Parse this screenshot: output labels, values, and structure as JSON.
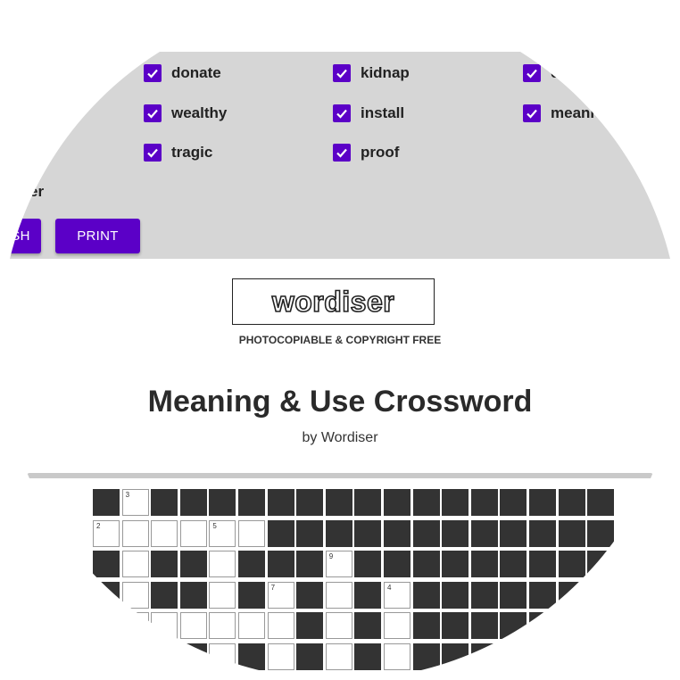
{
  "words": [
    [
      "donate",
      "kidnap",
      "c"
    ],
    [
      "wealthy",
      "install",
      "meani"
    ],
    [
      "tragic",
      "proof",
      ""
    ]
  ],
  "show_answer_label": "nswer",
  "buttons": {
    "left_label": "SH",
    "print_label": "PRINT"
  },
  "logo": {
    "text": "wordiser"
  },
  "photocopy_text": "PHOTOCOPIABLE & COPYRIGHT FREE",
  "title": "Meaning & Use Crossword",
  "byline": "by Wordiser",
  "colors": {
    "accent": "#5b00c7",
    "settings_bg": "#d6d6d6",
    "grid_black": "#333333"
  },
  "grid": {
    "rows": [
      "BWBBBBBBBBBBBBBBBB",
      "WWWWWWBBBBBBBBBBBB",
      "BWBBWBBBWBBBBBBBBB",
      "BWBBWBWBWBWBBBBBBB",
      "BWWWWWWBWBWBBBBBBB",
      "BBBBWBWBWBWBBBBBBB"
    ],
    "numbers": [
      {
        "r": 0,
        "c": 1,
        "n": "3"
      },
      {
        "r": 1,
        "c": 0,
        "n": "2"
      },
      {
        "r": 1,
        "c": 4,
        "n": "5"
      },
      {
        "r": 2,
        "c": 8,
        "n": "9"
      },
      {
        "r": 3,
        "c": 6,
        "n": "7"
      },
      {
        "r": 3,
        "c": 10,
        "n": "4"
      }
    ]
  }
}
